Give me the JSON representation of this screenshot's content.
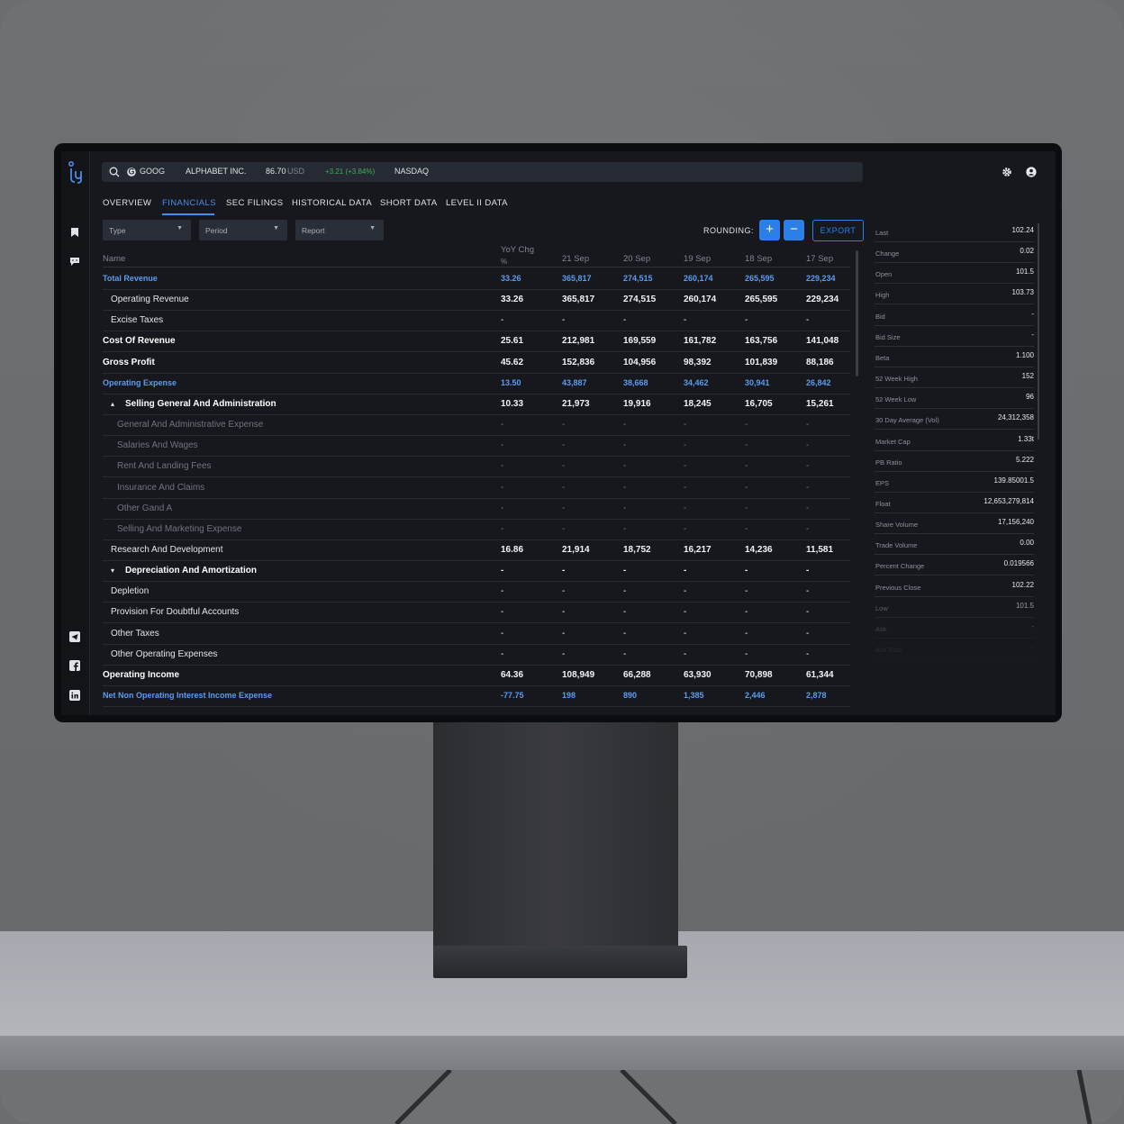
{
  "search": {
    "symbol": "GOOG",
    "company": "ALPHABET INC.",
    "price": "86.70",
    "currency": "USD",
    "change": "+3.21 (+3.84%)",
    "exchange": "NASDAQ"
  },
  "tabs": [
    "OVERVIEW",
    "FINANCIALS",
    "SEC FILINGS",
    "HISTORICAL DATA",
    "SHORT DATA",
    "LEVEL II DATA"
  ],
  "filters": {
    "type": "Type",
    "period": "Period",
    "report": "Report"
  },
  "toolbar": {
    "rounding_label": "ROUNDING:",
    "plus": "+",
    "minus": "−",
    "export": "EXPORT"
  },
  "table": {
    "headers": {
      "name": "Name",
      "yoy": "YoY Chg",
      "yoy_unit": "%",
      "c1": "21 Sep",
      "c2": "20 Sep",
      "c3": "19 Sep",
      "c4": "18 Sep",
      "c5": "17 Sep"
    },
    "rows": [
      {
        "name": "Total Revenue",
        "style": "blue",
        "indent": 0,
        "vals": [
          "33.26",
          "365,817",
          "274,515",
          "260,174",
          "265,595",
          "229,234"
        ]
      },
      {
        "name": "Operating Revenue",
        "style": "normal",
        "indent": 1,
        "vals": [
          "33.26",
          "365,817",
          "274,515",
          "260,174",
          "265,595",
          "229,234"
        ]
      },
      {
        "name": "Excise Taxes",
        "style": "normal",
        "indent": 1,
        "vals": [
          "-",
          "-",
          "-",
          "-",
          "-",
          "-"
        ]
      },
      {
        "name": "Cost Of Revenue",
        "style": "bold",
        "indent": 0,
        "vals": [
          "25.61",
          "212,981",
          "169,559",
          "161,782",
          "163,756",
          "141,048"
        ]
      },
      {
        "name": "Gross Profit",
        "style": "bold",
        "indent": 0,
        "vals": [
          "45.62",
          "152,836",
          "104,956",
          "98,392",
          "101,839",
          "88,186"
        ]
      },
      {
        "name": "Operating Expense",
        "style": "blue",
        "indent": 0,
        "vals": [
          "13.50",
          "43,887",
          "38,668",
          "34,462",
          "30,941",
          "26,842"
        ]
      },
      {
        "name": "Selling General And Administration",
        "style": "bold",
        "indent": 1,
        "caret": "▴",
        "vals": [
          "10.33",
          "21,973",
          "19,916",
          "18,245",
          "16,705",
          "15,261"
        ]
      },
      {
        "name": "General And Administrative Expense",
        "style": "muted",
        "indent": 2,
        "vals": [
          "-",
          "-",
          "-",
          "-",
          "-",
          "-"
        ]
      },
      {
        "name": "Salaries And Wages",
        "style": "muted",
        "indent": 2,
        "vals": [
          "-",
          "-",
          "-",
          "-",
          "-",
          "-"
        ]
      },
      {
        "name": "Rent And Landing Fees",
        "style": "muted",
        "indent": 2,
        "vals": [
          "-",
          "-",
          "-",
          "-",
          "-",
          "-"
        ]
      },
      {
        "name": "Insurance And Claims",
        "style": "muted",
        "indent": 2,
        "vals": [
          "-",
          "-",
          "-",
          "-",
          "-",
          "-"
        ]
      },
      {
        "name": "Other Gand A",
        "style": "muted",
        "indent": 2,
        "vals": [
          "-",
          "-",
          "-",
          "-",
          "-",
          "-"
        ]
      },
      {
        "name": "Selling And Marketing Expense",
        "style": "muted",
        "indent": 2,
        "vals": [
          "-",
          "-",
          "-",
          "-",
          "-",
          "-"
        ]
      },
      {
        "name": "Research And Development",
        "style": "normal",
        "indent": 1,
        "vals": [
          "16.86",
          "21,914",
          "18,752",
          "16,217",
          "14,236",
          "11,581"
        ]
      },
      {
        "name": "Depreciation And Amortization",
        "style": "bold",
        "indent": 1,
        "caret": "▾",
        "vals": [
          "-",
          "-",
          "-",
          "-",
          "-",
          "-"
        ]
      },
      {
        "name": "Depletion",
        "style": "normal",
        "indent": 1,
        "vals": [
          "-",
          "-",
          "-",
          "-",
          "-",
          "-"
        ]
      },
      {
        "name": "Provision For Doubtful Accounts",
        "style": "normal",
        "indent": 1,
        "vals": [
          "-",
          "-",
          "-",
          "-",
          "-",
          "-"
        ]
      },
      {
        "name": "Other Taxes",
        "style": "normal",
        "indent": 1,
        "vals": [
          "-",
          "-",
          "-",
          "-",
          "-",
          "-"
        ]
      },
      {
        "name": "Other Operating Expenses",
        "style": "normal",
        "indent": 1,
        "vals": [
          "-",
          "-",
          "-",
          "-",
          "-",
          "-"
        ]
      },
      {
        "name": "Operating Income",
        "style": "bold",
        "indent": 0,
        "vals": [
          "64.36",
          "108,949",
          "66,288",
          "63,930",
          "70,898",
          "61,344"
        ]
      },
      {
        "name": "Net Non Operating Interest Income Expense",
        "style": "blue",
        "indent": 0,
        "vals": [
          "-77.75",
          "198",
          "890",
          "1,385",
          "2,446",
          "2,878"
        ]
      }
    ]
  },
  "quote": [
    {
      "k": "Last",
      "v": "102.24"
    },
    {
      "k": "Change",
      "v": "0.02"
    },
    {
      "k": "Open",
      "v": "101.5"
    },
    {
      "k": "High",
      "v": "103.73"
    },
    {
      "k": "Bid",
      "v": "-"
    },
    {
      "k": "Bid Size",
      "v": "-"
    },
    {
      "k": "Beta",
      "v": "1.100"
    },
    {
      "k": "52 Week High",
      "v": "152"
    },
    {
      "k": "52 Week Low",
      "v": "96"
    },
    {
      "k": "30 Day Average (Vol)",
      "v": "24,312,358"
    },
    {
      "k": "Market Cap",
      "v": "1.33t"
    },
    {
      "k": "PB Ratio",
      "v": "5.222"
    },
    {
      "k": "EPS",
      "v": "139.85001.5"
    },
    {
      "k": "Float",
      "v": "12,653,279,814"
    },
    {
      "k": "Share Volume",
      "v": "17,156,240"
    },
    {
      "k": "Trade Volume",
      "v": "0.00"
    },
    {
      "k": "Percent Change",
      "v": "0.019566"
    },
    {
      "k": "Previous Close",
      "v": "102.22"
    },
    {
      "k": "Low",
      "v": "101.5"
    },
    {
      "k": "Ask",
      "v": "-"
    },
    {
      "k": "Ask Size",
      "v": "-"
    }
  ],
  "colors": {
    "accent": "#2c7fe8",
    "blue_text": "#5b9cf0",
    "positive": "#3fae5c",
    "bg": "#16181d"
  },
  "icons": {
    "logo": "brand-logo-icon",
    "search": "search-icon",
    "settings": "gear-icon",
    "user": "user-icon"
  }
}
